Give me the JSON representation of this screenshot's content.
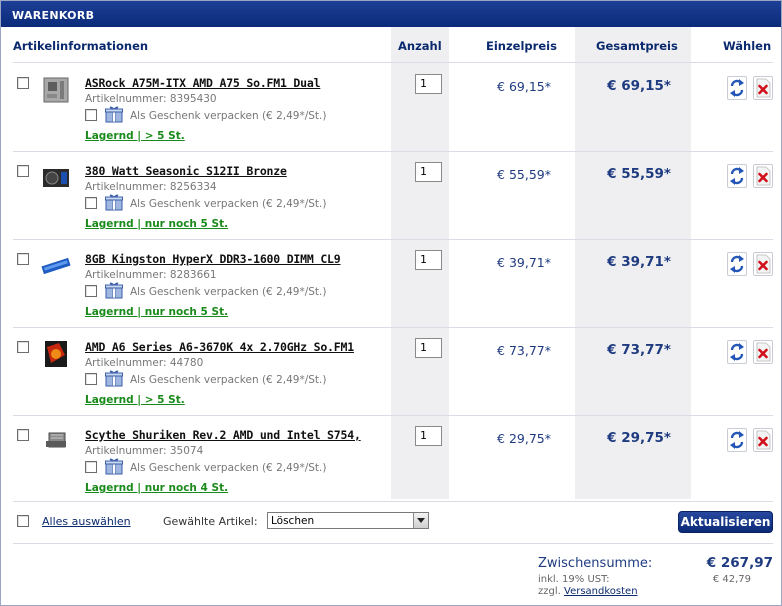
{
  "title": "WARENKORB",
  "headers": {
    "info": "Artikelinformationen",
    "qty": "Anzahl",
    "unit": "Einzelpreis",
    "total": "Gesamtpreis",
    "select": "Wählen"
  },
  "items": [
    {
      "name": "ASRock A75M-ITX AMD A75 So.FM1 Dual",
      "artnr": "Artikelnummer: 8395430",
      "gift": "Als Geschenk verpacken (€ 2,49*/St.)",
      "stock": "Lagernd | > 5 St.",
      "qty": "1",
      "unit_price": "€ 69,15*",
      "total_price": "€ 69,15*",
      "thumb": "motherboard-icon"
    },
    {
      "name": "380 Watt Seasonic S12II Bronze",
      "artnr": "Artikelnummer: 8256334",
      "gift": "Als Geschenk verpacken (€ 2,49*/St.)",
      "stock": "Lagernd | nur noch 5 St.",
      "qty": "1",
      "unit_price": "€ 55,59*",
      "total_price": "€ 55,59*",
      "thumb": "power-supply-icon"
    },
    {
      "name": "8GB Kingston HyperX DDR3-1600 DIMM CL9",
      "artnr": "Artikelnummer: 8283661",
      "gift": "Als Geschenk verpacken (€ 2,49*/St.)",
      "stock": "Lagernd | nur noch 5 St.",
      "qty": "1",
      "unit_price": "€ 39,71*",
      "total_price": "€ 39,71*",
      "thumb": "ram-icon"
    },
    {
      "name": "AMD A6 Series A6-3670K 4x 2.70GHz So.FM1",
      "artnr": "Artikelnummer: 44780",
      "gift": "Als Geschenk verpacken (€ 2,49*/St.)",
      "stock": "Lagernd | > 5 St.",
      "qty": "1",
      "unit_price": "€ 73,77*",
      "total_price": "€ 73,77*",
      "thumb": "cpu-box-icon"
    },
    {
      "name": "Scythe Shuriken Rev.2 AMD und Intel S754,",
      "artnr": "Artikelnummer: 35074",
      "gift": "Als Geschenk verpacken (€ 2,49*/St.)",
      "stock": "Lagernd | nur noch 4 St.",
      "qty": "1",
      "unit_price": "€ 29,75*",
      "total_price": "€ 29,75*",
      "thumb": "cpu-cooler-icon"
    }
  ],
  "footer": {
    "select_all": "Alles auswählen",
    "selected_label": "Gewählte Artikel:",
    "action_selected": "Löschen",
    "update_button": "Aktualisieren"
  },
  "summary": {
    "subtotal_label": "Zwischensumme:",
    "subtotal_value": "€ 267,97",
    "vat_label": "inkl. 19% UST:",
    "vat_value": "€ 42,79",
    "shipping_prefix": "zzgl.",
    "shipping_link": "Versandkosten"
  },
  "colors": {
    "title_bar": "#0b2a7a",
    "header_text": "#0b2a6e",
    "price": "#1e3b80",
    "stock": "#1a8a1a",
    "column_shade": "#efeff1"
  }
}
